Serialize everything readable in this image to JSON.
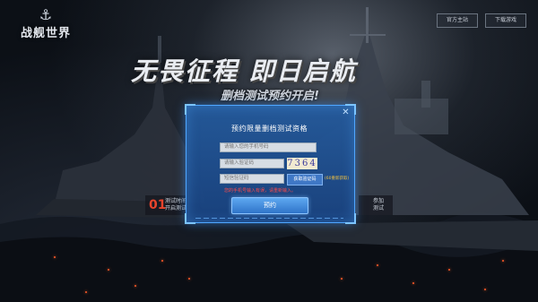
{
  "header": {
    "logo_text": "战舰世界",
    "button_left": "官方主站",
    "button_right": "下载游戏"
  },
  "hero": {
    "slogan": "无畏征程 即日启航",
    "subslogan": "删档测试预约开启!"
  },
  "badges": {
    "left_num": "01",
    "left_text": "测试时间\n开启测试",
    "right_text": "参加\n测试"
  },
  "dialog": {
    "title": "预约限量删档测试资格",
    "phone_placeholder": "请输入您的手机号码",
    "captcha_placeholder": "请输入验证码",
    "captcha_value": "7364",
    "sms_placeholder": "短信验证码",
    "sms_button": "获取验证码",
    "countdown": "(60重新获取)",
    "error_text": "您的手机号输入有误，请重新输入。",
    "submit": "预约"
  },
  "colors": {
    "dialog_bg": "#245ca0",
    "accent": "#4fa6ff",
    "error": "#ff4a4a",
    "ember": "#ff5a2a"
  }
}
